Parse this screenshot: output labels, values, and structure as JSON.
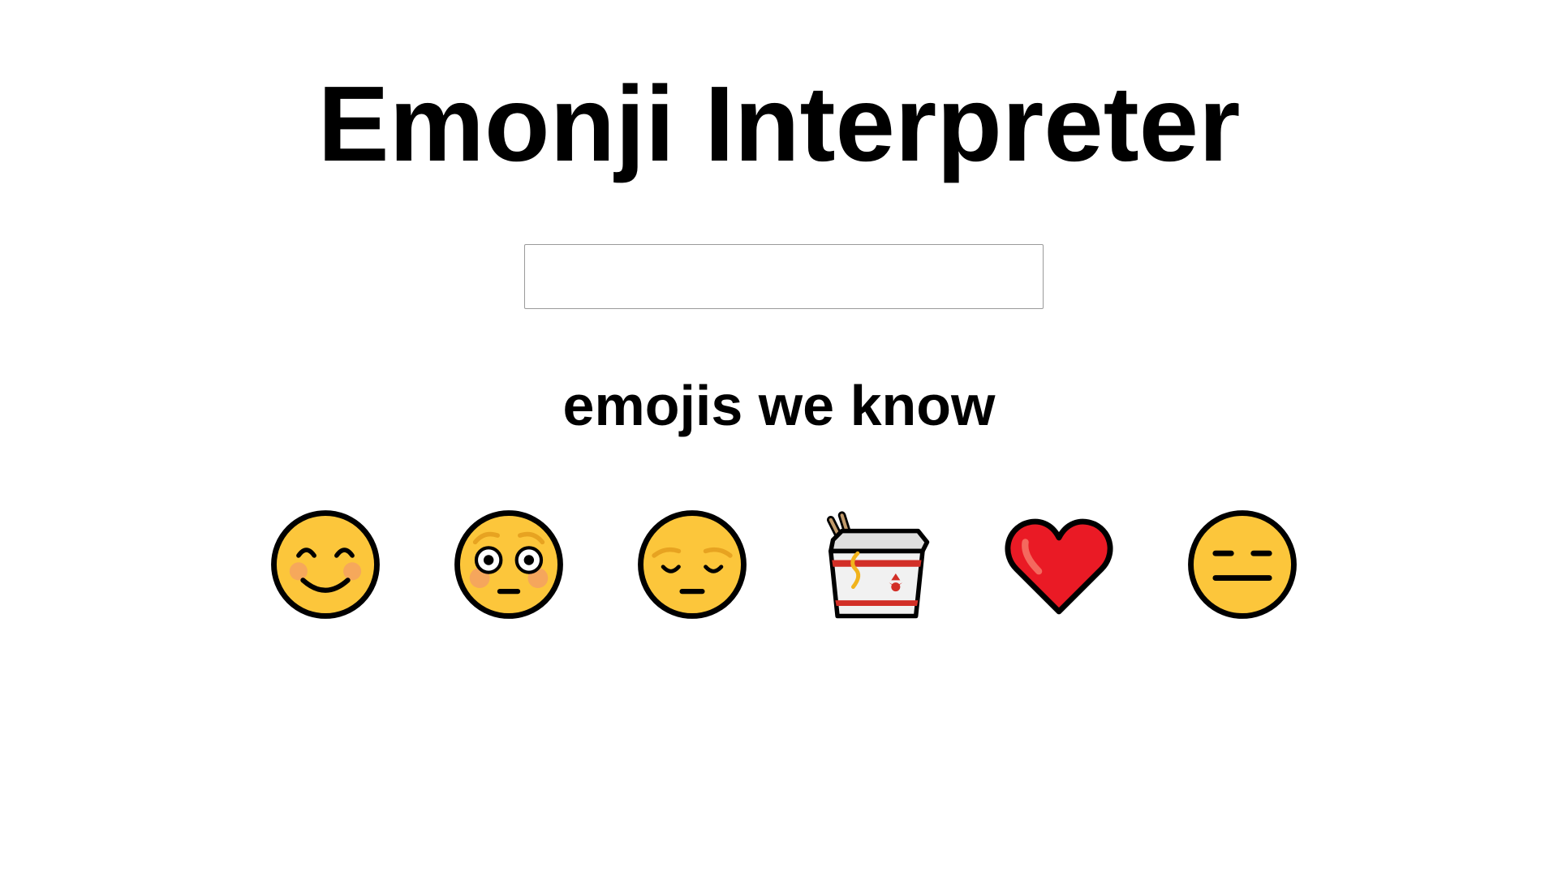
{
  "header": {
    "title": "Emonji Interpreter"
  },
  "search": {
    "value": "",
    "placeholder": ""
  },
  "known": {
    "heading": "emojis we know",
    "emojis": [
      {
        "icon": "smiling-face-with-smiling-eyes-icon"
      },
      {
        "icon": "flushed-face-icon"
      },
      {
        "icon": "pensive-face-icon"
      },
      {
        "icon": "takeout-box-icon"
      },
      {
        "icon": "red-heart-icon"
      },
      {
        "icon": "expressionless-face-icon"
      }
    ]
  },
  "colors": {
    "face_yellow": "#FCC63B",
    "outline": "#000000",
    "blush": "#F4A261",
    "heart_red": "#EA1A25",
    "heart_highlight": "#F4695E",
    "brow_orange": "#E7A321",
    "box_white": "#F1F1F1",
    "box_stripe": "#D22F27",
    "noodle": "#F1B31C"
  }
}
